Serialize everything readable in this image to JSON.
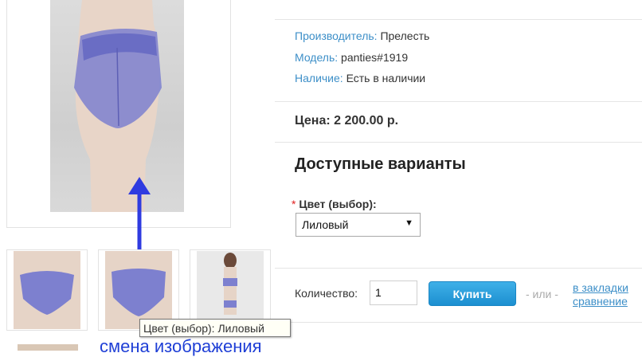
{
  "product": {
    "manufacturer_label": "Производитель:",
    "manufacturer_value": "Прелесть",
    "model_label": "Модель:",
    "model_value": "panties#1919",
    "availability_label": "Наличие:",
    "availability_value": "Есть в наличии",
    "price": "Цена: 2 200.00 р."
  },
  "options": {
    "title": "Доступные варианты",
    "required_mark": "*",
    "color_label": "Цвет (выбор):",
    "color_selected": "Лиловый"
  },
  "purchase": {
    "quantity_label": "Количество:",
    "quantity_value": "1",
    "buy_label": "Купить",
    "or_text": "- или -",
    "bookmark_link": "в закладки",
    "compare_link": "сравнение"
  },
  "tooltip": "Цвет (выбор): Лиловый",
  "annotation": {
    "caption": "смена изображения",
    "arrow_color": "#2f3be0"
  },
  "colors": {
    "accent_link": "#3d8fc8",
    "button": "#1c8fd0",
    "garment": "#7d80cf"
  }
}
